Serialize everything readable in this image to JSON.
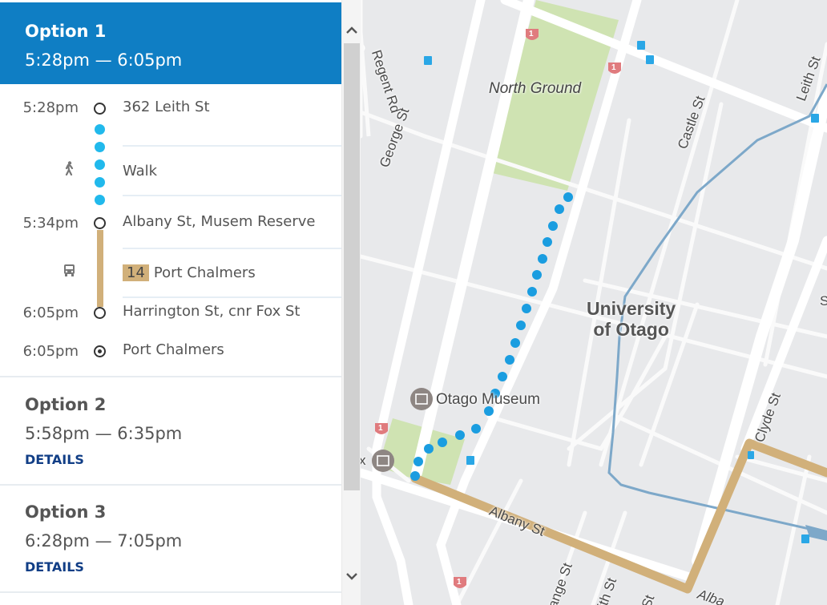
{
  "scroll": {
    "up_icon": "chevron-up-icon",
    "down_icon": "chevron-down-icon"
  },
  "colors": {
    "active_option_bg": "#0f7ec4",
    "walk": "#21b9ec",
    "bus": "#d1b07a",
    "details_link": "#113e86"
  },
  "options": [
    {
      "title": "Option 1",
      "time": "5:28pm — 6:05pm",
      "expanded": true,
      "steps": [
        {
          "time": "5:28pm",
          "label": "362 Leith St",
          "type": "stop"
        },
        {
          "mode": "walk",
          "icon": "walk-icon",
          "label": "Walk"
        },
        {
          "time": "5:34pm",
          "label": "Albany St, Musem Reserve",
          "type": "stop"
        },
        {
          "mode": "bus",
          "icon": "bus-icon",
          "route": "14",
          "label": "Port Chalmers"
        },
        {
          "time": "6:05pm",
          "label": "Harrington St, cnr Fox St",
          "type": "stop"
        },
        {
          "time": "6:05pm",
          "label": "Port Chalmers",
          "type": "destination"
        }
      ]
    },
    {
      "title": "Option 2",
      "time": "5:58pm — 6:35pm",
      "details_label": "DETAILS"
    },
    {
      "title": "Option 3",
      "time": "6:28pm — 7:05pm",
      "details_label": "DETAILS"
    }
  ],
  "map": {
    "labels": {
      "regent_rd": "Regent Rd",
      "george_st": "George St",
      "north_ground": "North Ground",
      "castle_st": "Castle St",
      "leith_st": "Leith St",
      "university": "University",
      "of_otago": "of Otago",
      "otago_museum": "Otago Museum",
      "clyde_st": "Clyde St",
      "albany_st": "Albany St",
      "grange_st": "ange St",
      "smith_st": "ith St",
      "st": "St",
      "alba": "Alba",
      "x": "x",
      "s_edge": "S"
    },
    "highway_shield": "1"
  }
}
